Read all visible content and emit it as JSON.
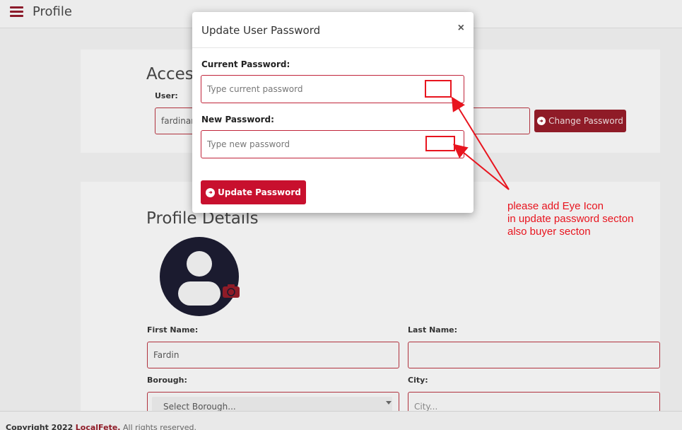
{
  "header": {
    "title": "Profile",
    "menu_icon": "hamburger-icon"
  },
  "access": {
    "title": "Access",
    "user_label": "User:",
    "user_value": "fardinam",
    "change_password_label": "Change Password"
  },
  "profile": {
    "title": "Profile Details",
    "first_name_label": "First Name:",
    "first_name_value": "Fardin",
    "last_name_label": "Last Name:",
    "last_name_value": "",
    "borough_label": "Borough:",
    "borough_selected": "Select Borough...",
    "city_label": "City:",
    "city_placeholder": "City..."
  },
  "modal": {
    "title": "Update User Password",
    "close_glyph": "×",
    "current_label": "Current Password:",
    "current_placeholder": "Type current password",
    "new_label": "New Password:",
    "new_placeholder": "Type new password",
    "submit_label": "Update Password"
  },
  "annotation": {
    "line1": "please add Eye Icon",
    "line2": "in update password secton",
    "line3": "also buyer secton",
    "color": "#e8141e"
  },
  "footer": {
    "prefix": "Copyright 2022",
    "brand": "LocalFete.",
    "suffix": "All rights reserved."
  },
  "colors": {
    "brand": "#c8102e",
    "dark_brand": "#8f1b27"
  }
}
